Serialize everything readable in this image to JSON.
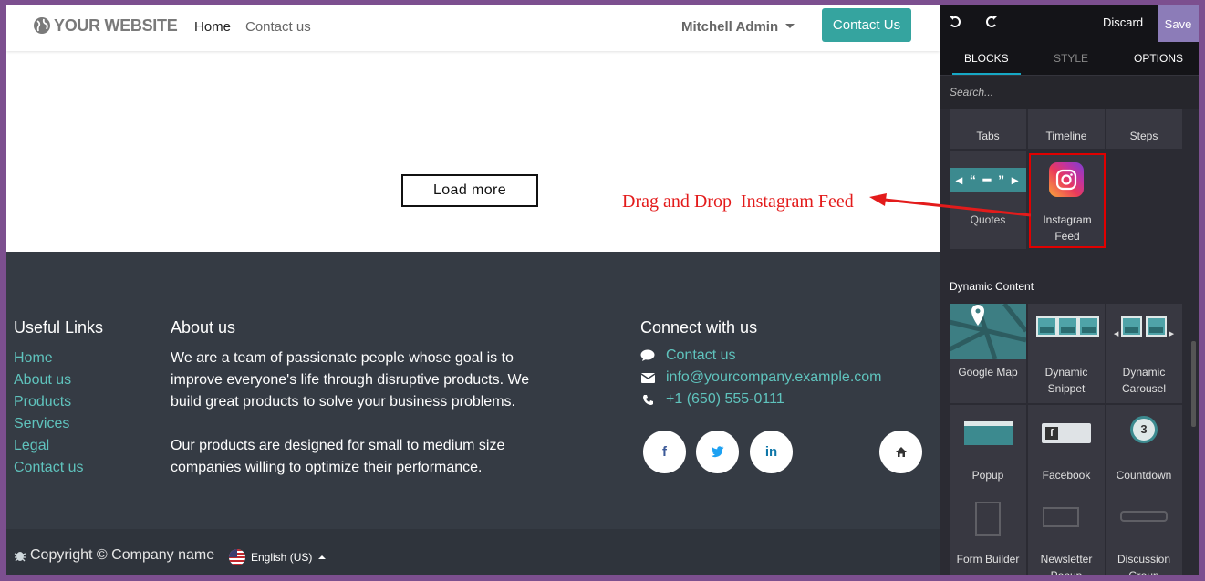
{
  "site": {
    "logo_text": "YOUR WEBSITE",
    "nav": {
      "home": "Home",
      "contact": "Contact us"
    },
    "user": "Mitchell Admin",
    "cta": "Contact Us",
    "load_more": "Load more"
  },
  "annotation": {
    "text": "Drag and Drop  Instagram Feed",
    "color": "#e31b1b"
  },
  "footer": {
    "useful_links_title": "Useful Links",
    "links": [
      "Home",
      "About us",
      "Products",
      "Services",
      "Legal",
      "Contact us"
    ],
    "about_title": "About us",
    "about_p1": "We are a team of passionate people whose goal is to improve everyone's life through disruptive products. We build great products to solve your business problems.",
    "about_p2": "Our products are designed for small to medium size companies willing to optimize their performance.",
    "connect_title": "Connect with us",
    "contact_link": "Contact us",
    "email": "info@yourcompany.example.com",
    "phone": "+1 (650) 555-0111",
    "copyright": "Copyright © Company name",
    "language": "English (US)"
  },
  "editor": {
    "discard": "Discard",
    "save": "Save",
    "tabs": {
      "blocks": "BLOCKS",
      "style": "STYLE",
      "options": "OPTIONS"
    },
    "search_placeholder": "Search...",
    "snippets_top": {
      "tabs": "Tabs",
      "timeline": "Timeline",
      "steps": "Steps"
    },
    "quotes": "Quotes",
    "instagram": "Instagram Feed",
    "dynamic_title": "Dynamic Content",
    "dynamic": {
      "google_map": "Google Map",
      "dynamic_snippet": "Dynamic Snippet",
      "dynamic_carousel": "Dynamic Carousel",
      "popup": "Popup",
      "facebook": "Facebook",
      "countdown": "Countdown",
      "form_builder": "Form Builder",
      "newsletter": "Newsletter Popup",
      "discussion": "Discussion Group"
    }
  },
  "colors": {
    "accent": "#35a49f",
    "footer_bg": "#353b44",
    "link": "#5fc3bd",
    "panel_bg": "#2b2b33",
    "save": "#8c7cb8"
  }
}
